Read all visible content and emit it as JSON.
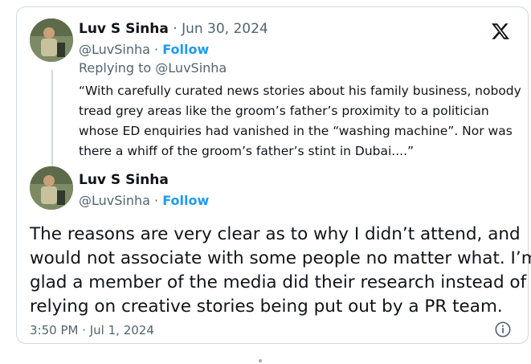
{
  "parent_tweet": {
    "author_name": "Luv S Sinha",
    "date": "· Jun 30, 2024",
    "handle": "@LuvSinha",
    "follow_label": "Follow",
    "replying_to": "Replying to @LuvSinha",
    "text_lines": [
      "“With carefully curated news stories about his family business, nobody",
      "tread grey areas like the groom’s father’s proximity to a politician",
      "whose ED enquiries had vanished in the “washing machine”. Nor was",
      "there a whiff of the groom’s father’s stint in Dubai....”"
    ]
  },
  "reply_tweet": {
    "author_name": "Luv S Sinha",
    "handle": "@LuvSinha",
    "follow_label": "Follow",
    "text_lines": [
      "The reasons are very clear as to why I didn’t attend, and",
      "would not associate with some people no matter what. I’m",
      "glad a member of the media did their research instead of",
      "relying on creative stories being put out by a PR team."
    ],
    "timestamp": "3:50 PM · Jul 1, 2024"
  },
  "separator": "·",
  "icons": {
    "logo": "x-logo-icon",
    "info": "info-icon"
  },
  "colors": {
    "accent": "#1d9bf0",
    "secondary_text": "#536471",
    "border": "#cfd9de"
  }
}
